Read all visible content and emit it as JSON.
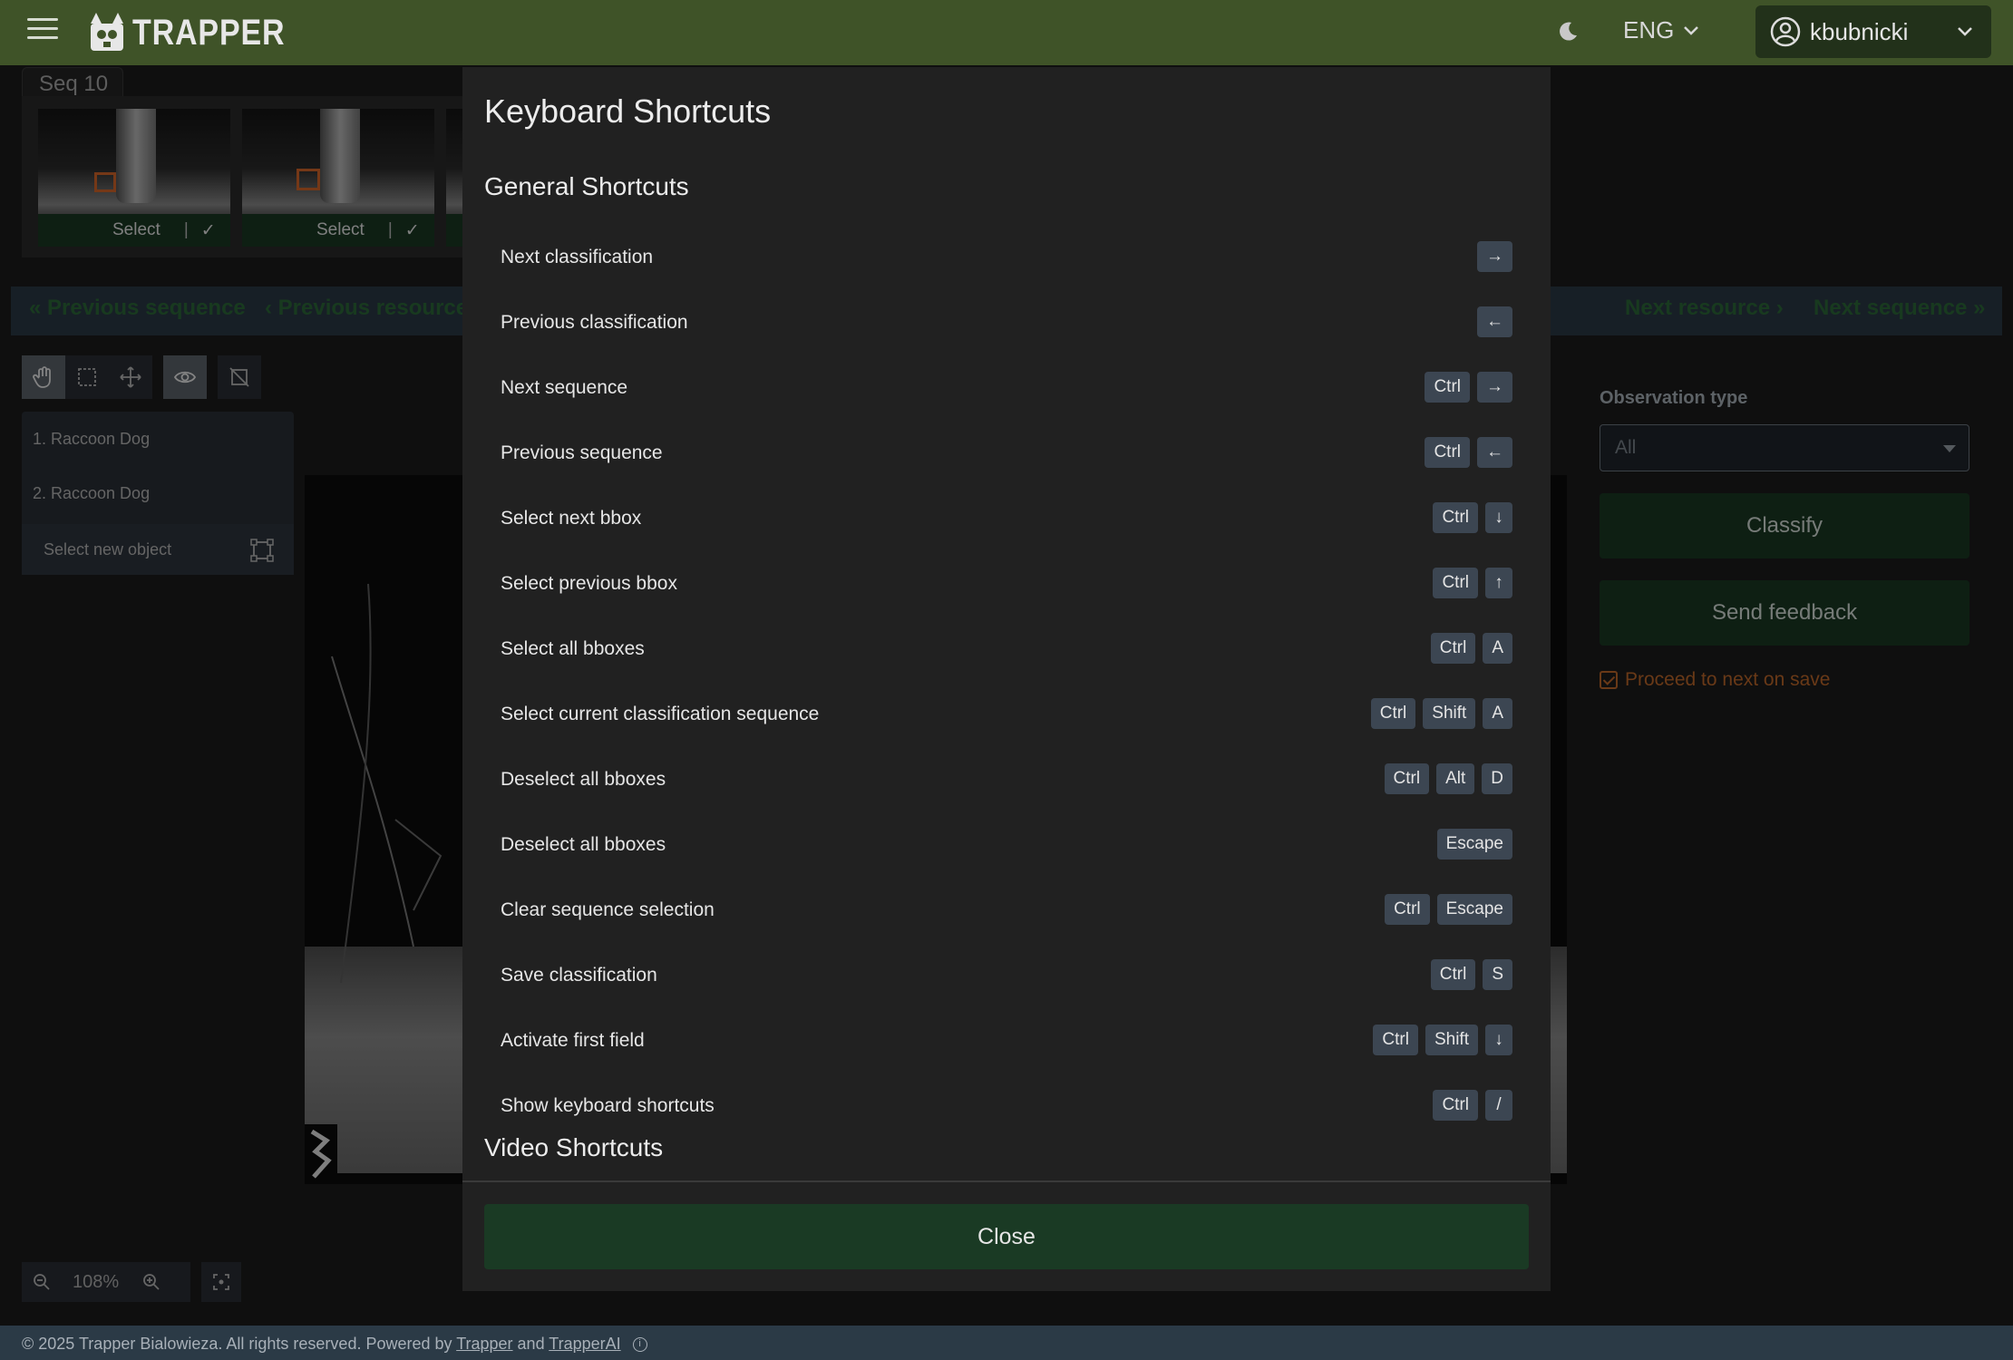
{
  "header": {
    "app_name": "TRAPPER",
    "language": "ENG",
    "username": "kbubnicki"
  },
  "sequence": {
    "tag": "Seq 10",
    "thumb_select_label": "Select",
    "thumb_check": "✓"
  },
  "nav": {
    "previous_sequence": "Previous sequence",
    "previous_resource": "Previous resource",
    "next_resource": "Next resource",
    "next_sequence": "Next sequence"
  },
  "objects": {
    "items": [
      "1. Raccoon Dog",
      "2. Raccoon Dog"
    ],
    "select_new": "Select new object"
  },
  "zoom": {
    "level": "108%"
  },
  "panel": {
    "observation_type_label": "Observation type",
    "observation_type_value": "All",
    "classify": "Classify",
    "send_feedback": "Send feedback",
    "proceed_label": "Proceed to next on save"
  },
  "footer": {
    "text": "© 2025 Trapper Bialowieza. All rights reserved. Powered by ",
    "link1": "Trapper",
    "and": " and ",
    "link2": "TrapperAI"
  },
  "modal": {
    "title": "Keyboard Shortcuts",
    "general_heading": "General Shortcuts",
    "video_heading": "Video Shortcuts",
    "close": "Close",
    "shortcuts": [
      {
        "label": "Next classification",
        "keys": [
          "→"
        ]
      },
      {
        "label": "Previous classification",
        "keys": [
          "←"
        ]
      },
      {
        "label": "Next sequence",
        "keys": [
          "Ctrl",
          "→"
        ]
      },
      {
        "label": "Previous sequence",
        "keys": [
          "Ctrl",
          "←"
        ]
      },
      {
        "label": "Select next bbox",
        "keys": [
          "Ctrl",
          "↓"
        ]
      },
      {
        "label": "Select previous bbox",
        "keys": [
          "Ctrl",
          "↑"
        ]
      },
      {
        "label": "Select all bboxes",
        "keys": [
          "Ctrl",
          "A"
        ]
      },
      {
        "label": "Select current classification sequence",
        "keys": [
          "Ctrl",
          "Shift",
          "A"
        ]
      },
      {
        "label": "Deselect all bboxes",
        "keys": [
          "Ctrl",
          "Alt",
          "D"
        ]
      },
      {
        "label": "Deselect all bboxes",
        "keys": [
          "Escape"
        ]
      },
      {
        "label": "Clear sequence selection",
        "keys": [
          "Ctrl",
          "Escape"
        ]
      },
      {
        "label": "Save classification",
        "keys": [
          "Ctrl",
          "S"
        ]
      },
      {
        "label": "Activate first field",
        "keys": [
          "Ctrl",
          "Shift",
          "↓"
        ]
      },
      {
        "label": "Show keyboard shortcuts",
        "keys": [
          "Ctrl",
          "/"
        ]
      }
    ]
  }
}
